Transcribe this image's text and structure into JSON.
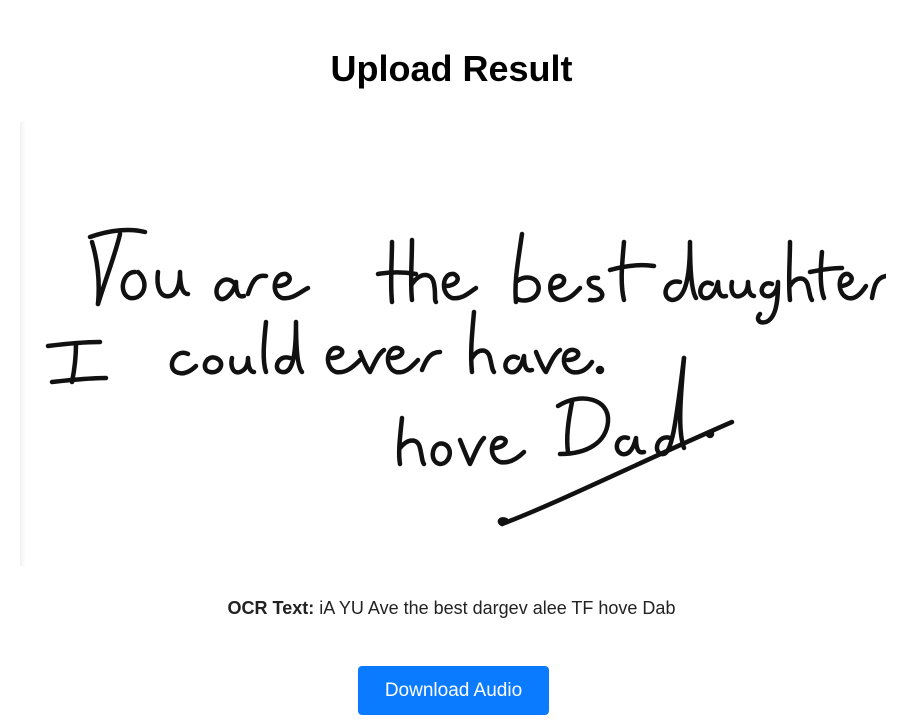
{
  "page": {
    "title": "Upload Result"
  },
  "uploaded_image": {
    "handwritten_text": "You are the best daughter I could ever have. love Dad."
  },
  "ocr": {
    "label": "OCR Text:",
    "value": "iA YU Ave the best dargev alee TF hove Dab"
  },
  "actions": {
    "download_audio_label": "Download Audio"
  },
  "colors": {
    "button_background": "#0a7bff",
    "button_text": "#ffffff",
    "ink": "#111111"
  }
}
